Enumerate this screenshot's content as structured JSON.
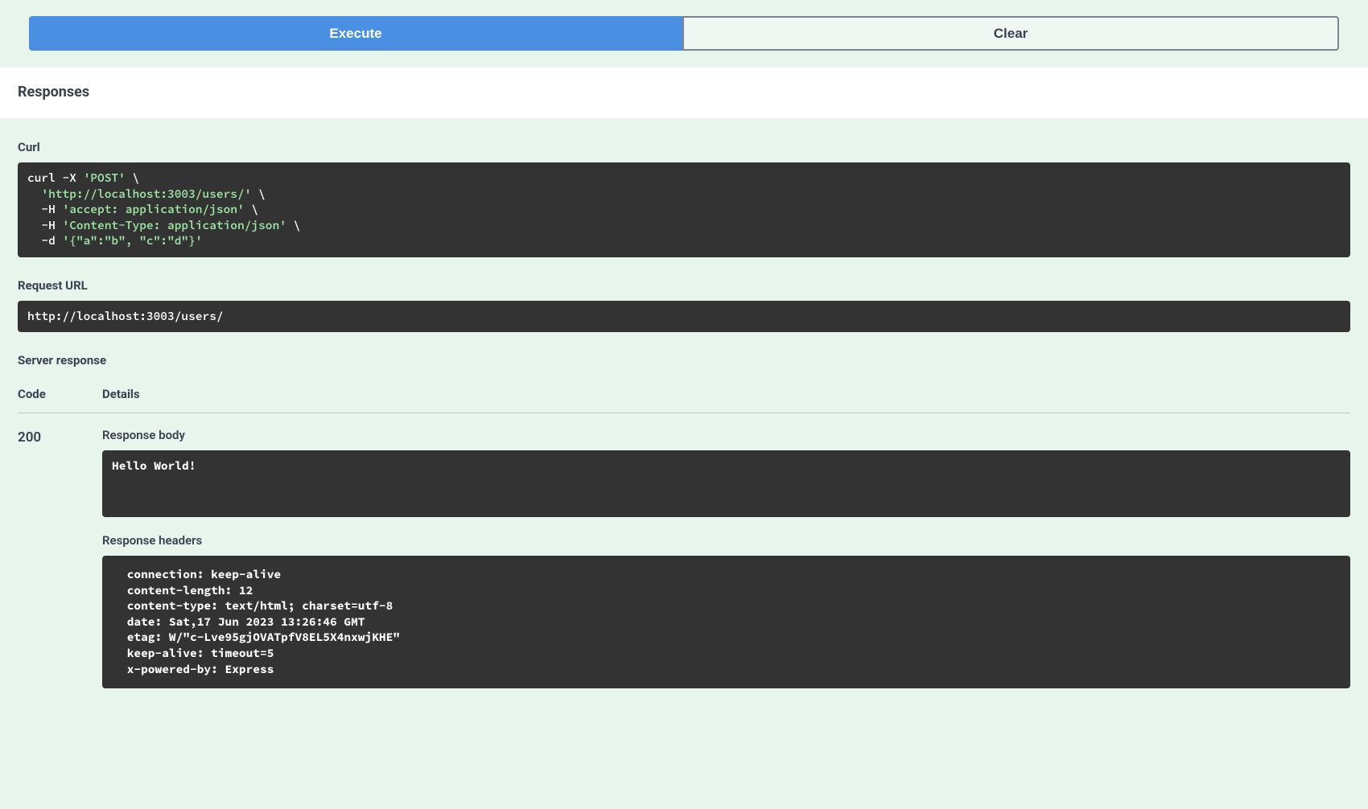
{
  "buttons": {
    "execute": "Execute",
    "clear": "Clear"
  },
  "responses_title": "Responses",
  "labels": {
    "curl": "Curl",
    "request_url": "Request URL",
    "server_response": "Server response",
    "code": "Code",
    "details": "Details",
    "response_body": "Response body",
    "response_headers": "Response headers"
  },
  "curl_cmd": {
    "line1_pre": "curl -X ",
    "line1_method": "'POST'",
    "line1_suf": " \\",
    "line2_pre": "  ",
    "line2_url": "'http://localhost:3003/users/'",
    "line2_suf": " \\",
    "line3_pre": "  -H ",
    "line3_h1": "'accept: application/json'",
    "line3_suf": " \\",
    "line4_pre": "  -H ",
    "line4_h2": "'Content-Type: application/json'",
    "line4_suf": " \\",
    "line5_pre": "  -d ",
    "line5_body": "'{\"a\":\"b\", \"c\":\"d\"}'"
  },
  "request_url": "http://localhost:3003/users/",
  "response": {
    "code": "200",
    "body": "Hello World!",
    "headers": " connection: keep-alive \n content-length: 12 \n content-type: text/html; charset=utf-8 \n date: Sat,17 Jun 2023 13:26:46 GMT \n etag: W/\"c-Lve95gjOVATpfV8EL5X4nxwjKHE\" \n keep-alive: timeout=5 \n x-powered-by: Express "
  }
}
